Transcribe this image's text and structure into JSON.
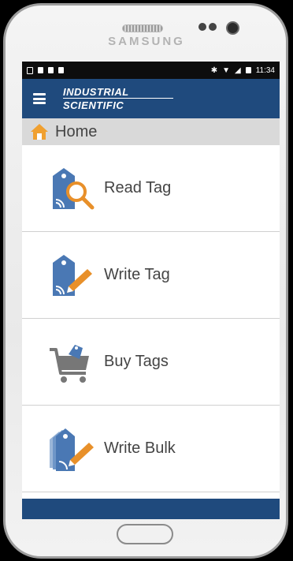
{
  "device": {
    "brand": "SAMSUNG"
  },
  "status_bar": {
    "time": "11:34"
  },
  "app": {
    "logo_line1": "INDUSTRIAL",
    "logo_line2": "SCIENTIFIC",
    "accent": "#1f4a7d",
    "breadcrumb_bg": "#d9d9d9"
  },
  "breadcrumb": {
    "label": "Home",
    "icon": "home-icon"
  },
  "menu": {
    "items": [
      {
        "label": "Read Tag",
        "icon": "read-tag-icon"
      },
      {
        "label": "Write Tag",
        "icon": "write-tag-icon"
      },
      {
        "label": "Buy Tags",
        "icon": "buy-tags-icon"
      },
      {
        "label": "Write Bulk",
        "icon": "write-bulk-icon"
      }
    ]
  }
}
